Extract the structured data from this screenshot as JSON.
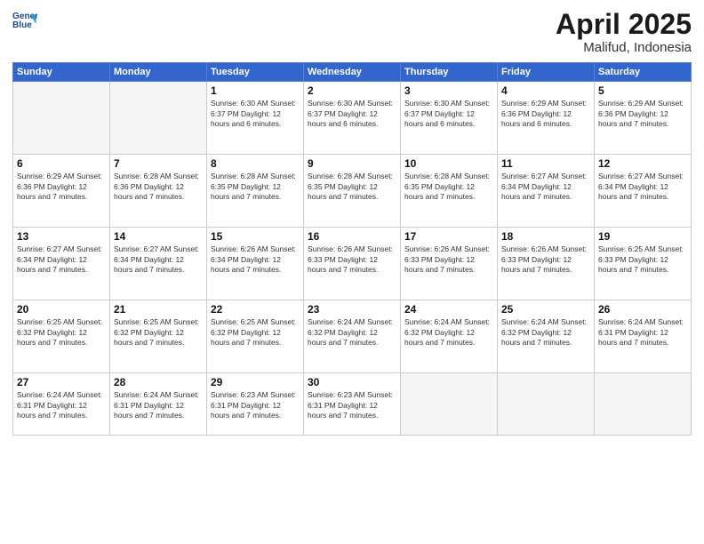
{
  "logo": {
    "line1": "General",
    "line2": "Blue"
  },
  "title": "April 2025",
  "subtitle": "Malifud, Indonesia",
  "weekdays": [
    "Sunday",
    "Monday",
    "Tuesday",
    "Wednesday",
    "Thursday",
    "Friday",
    "Saturday"
  ],
  "weeks": [
    [
      {
        "day": "",
        "info": ""
      },
      {
        "day": "",
        "info": ""
      },
      {
        "day": "1",
        "info": "Sunrise: 6:30 AM\nSunset: 6:37 PM\nDaylight: 12 hours\nand 6 minutes."
      },
      {
        "day": "2",
        "info": "Sunrise: 6:30 AM\nSunset: 6:37 PM\nDaylight: 12 hours\nand 6 minutes."
      },
      {
        "day": "3",
        "info": "Sunrise: 6:30 AM\nSunset: 6:37 PM\nDaylight: 12 hours\nand 6 minutes."
      },
      {
        "day": "4",
        "info": "Sunrise: 6:29 AM\nSunset: 6:36 PM\nDaylight: 12 hours\nand 6 minutes."
      },
      {
        "day": "5",
        "info": "Sunrise: 6:29 AM\nSunset: 6:36 PM\nDaylight: 12 hours\nand 7 minutes."
      }
    ],
    [
      {
        "day": "6",
        "info": "Sunrise: 6:29 AM\nSunset: 6:36 PM\nDaylight: 12 hours\nand 7 minutes."
      },
      {
        "day": "7",
        "info": "Sunrise: 6:28 AM\nSunset: 6:36 PM\nDaylight: 12 hours\nand 7 minutes."
      },
      {
        "day": "8",
        "info": "Sunrise: 6:28 AM\nSunset: 6:35 PM\nDaylight: 12 hours\nand 7 minutes."
      },
      {
        "day": "9",
        "info": "Sunrise: 6:28 AM\nSunset: 6:35 PM\nDaylight: 12 hours\nand 7 minutes."
      },
      {
        "day": "10",
        "info": "Sunrise: 6:28 AM\nSunset: 6:35 PM\nDaylight: 12 hours\nand 7 minutes."
      },
      {
        "day": "11",
        "info": "Sunrise: 6:27 AM\nSunset: 6:34 PM\nDaylight: 12 hours\nand 7 minutes."
      },
      {
        "day": "12",
        "info": "Sunrise: 6:27 AM\nSunset: 6:34 PM\nDaylight: 12 hours\nand 7 minutes."
      }
    ],
    [
      {
        "day": "13",
        "info": "Sunrise: 6:27 AM\nSunset: 6:34 PM\nDaylight: 12 hours\nand 7 minutes."
      },
      {
        "day": "14",
        "info": "Sunrise: 6:27 AM\nSunset: 6:34 PM\nDaylight: 12 hours\nand 7 minutes."
      },
      {
        "day": "15",
        "info": "Sunrise: 6:26 AM\nSunset: 6:34 PM\nDaylight: 12 hours\nand 7 minutes."
      },
      {
        "day": "16",
        "info": "Sunrise: 6:26 AM\nSunset: 6:33 PM\nDaylight: 12 hours\nand 7 minutes."
      },
      {
        "day": "17",
        "info": "Sunrise: 6:26 AM\nSunset: 6:33 PM\nDaylight: 12 hours\nand 7 minutes."
      },
      {
        "day": "18",
        "info": "Sunrise: 6:26 AM\nSunset: 6:33 PM\nDaylight: 12 hours\nand 7 minutes."
      },
      {
        "day": "19",
        "info": "Sunrise: 6:25 AM\nSunset: 6:33 PM\nDaylight: 12 hours\nand 7 minutes."
      }
    ],
    [
      {
        "day": "20",
        "info": "Sunrise: 6:25 AM\nSunset: 6:32 PM\nDaylight: 12 hours\nand 7 minutes."
      },
      {
        "day": "21",
        "info": "Sunrise: 6:25 AM\nSunset: 6:32 PM\nDaylight: 12 hours\nand 7 minutes."
      },
      {
        "day": "22",
        "info": "Sunrise: 6:25 AM\nSunset: 6:32 PM\nDaylight: 12 hours\nand 7 minutes."
      },
      {
        "day": "23",
        "info": "Sunrise: 6:24 AM\nSunset: 6:32 PM\nDaylight: 12 hours\nand 7 minutes."
      },
      {
        "day": "24",
        "info": "Sunrise: 6:24 AM\nSunset: 6:32 PM\nDaylight: 12 hours\nand 7 minutes."
      },
      {
        "day": "25",
        "info": "Sunrise: 6:24 AM\nSunset: 6:32 PM\nDaylight: 12 hours\nand 7 minutes."
      },
      {
        "day": "26",
        "info": "Sunrise: 6:24 AM\nSunset: 6:31 PM\nDaylight: 12 hours\nand 7 minutes."
      }
    ],
    [
      {
        "day": "27",
        "info": "Sunrise: 6:24 AM\nSunset: 6:31 PM\nDaylight: 12 hours\nand 7 minutes."
      },
      {
        "day": "28",
        "info": "Sunrise: 6:24 AM\nSunset: 6:31 PM\nDaylight: 12 hours\nand 7 minutes."
      },
      {
        "day": "29",
        "info": "Sunrise: 6:23 AM\nSunset: 6:31 PM\nDaylight: 12 hours\nand 7 minutes."
      },
      {
        "day": "30",
        "info": "Sunrise: 6:23 AM\nSunset: 6:31 PM\nDaylight: 12 hours\nand 7 minutes."
      },
      {
        "day": "",
        "info": ""
      },
      {
        "day": "",
        "info": ""
      },
      {
        "day": "",
        "info": ""
      }
    ]
  ]
}
